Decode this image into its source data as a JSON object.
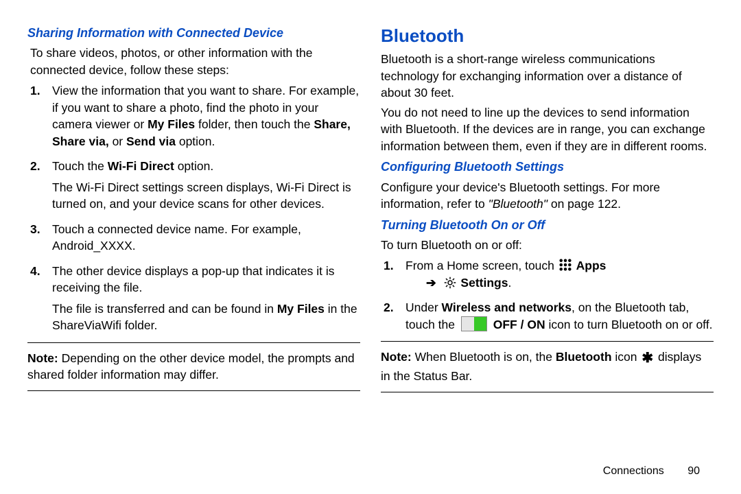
{
  "left": {
    "heading": "Sharing Information with Connected Device",
    "intro": "To share videos, photos, or other information with the connected device, follow these steps:",
    "item1_a": "View the information that you want to share. For example, if you want to share a photo, find the photo in your camera viewer or ",
    "item1_myfiles": "My Files",
    "item1_b": " folder, then touch the ",
    "item1_share": "Share, Share via,",
    "item1_or": " or ",
    "item1_sendvia": "Send via",
    "item1_c": " option.",
    "item2_a": "Touch the ",
    "item2_wfd": "Wi-Fi Direct",
    "item2_b": " option.",
    "item2_cont": "The Wi-Fi Direct settings screen displays, Wi-Fi Direct is turned on, and your device scans for other devices.",
    "item3": "Touch a connected device name. For example, Android_XXXX.",
    "item4": "The other device displays a pop-up that indicates it is receiving the file.",
    "item4_cont_a": "The file is transferred and can be found in ",
    "item4_cont_myfiles": "My Files",
    "item4_cont_b": " in the ShareViaWifi folder.",
    "note_label": "Note:",
    "note_text": " Depending on the other device model, the prompts and shared folder information may differ."
  },
  "right": {
    "section": "Bluetooth",
    "p1": "Bluetooth is a short-range wireless communications technology for exchanging information over a distance of about 30 feet.",
    "p2": "You do not need to line up the devices to send information with Bluetooth. If the devices are in range, you can exchange information between them, even if they are in different rooms.",
    "h_config": "Configuring Bluetooth Settings",
    "config_a": "Configure your device's Bluetooth settings. For more information, refer to ",
    "config_ref": "\"Bluetooth\"",
    "config_b": " on page 122.",
    "h_turn": "Turning Bluetooth On or Off",
    "turn_intro": "To turn Bluetooth on or off:",
    "step1_a": "From a Home screen, touch ",
    "step1_apps": "Apps",
    "step1_arrow": "➔",
    "step1_settings": "Settings",
    "step1_period": ".",
    "step2_a": "Under ",
    "step2_wn": "Wireless and networks",
    "step2_b": ", on the Bluetooth tab, touch the ",
    "step2_offon": "OFF / ON",
    "step2_c": " icon to turn Bluetooth on or off.",
    "note_label": "Note:",
    "note_a": " When Bluetooth is on, the ",
    "note_bold": "Bluetooth",
    "note_b": " icon ",
    "note_c": " displays in the Status Bar."
  },
  "footer": {
    "section": "Connections",
    "page": "90"
  }
}
